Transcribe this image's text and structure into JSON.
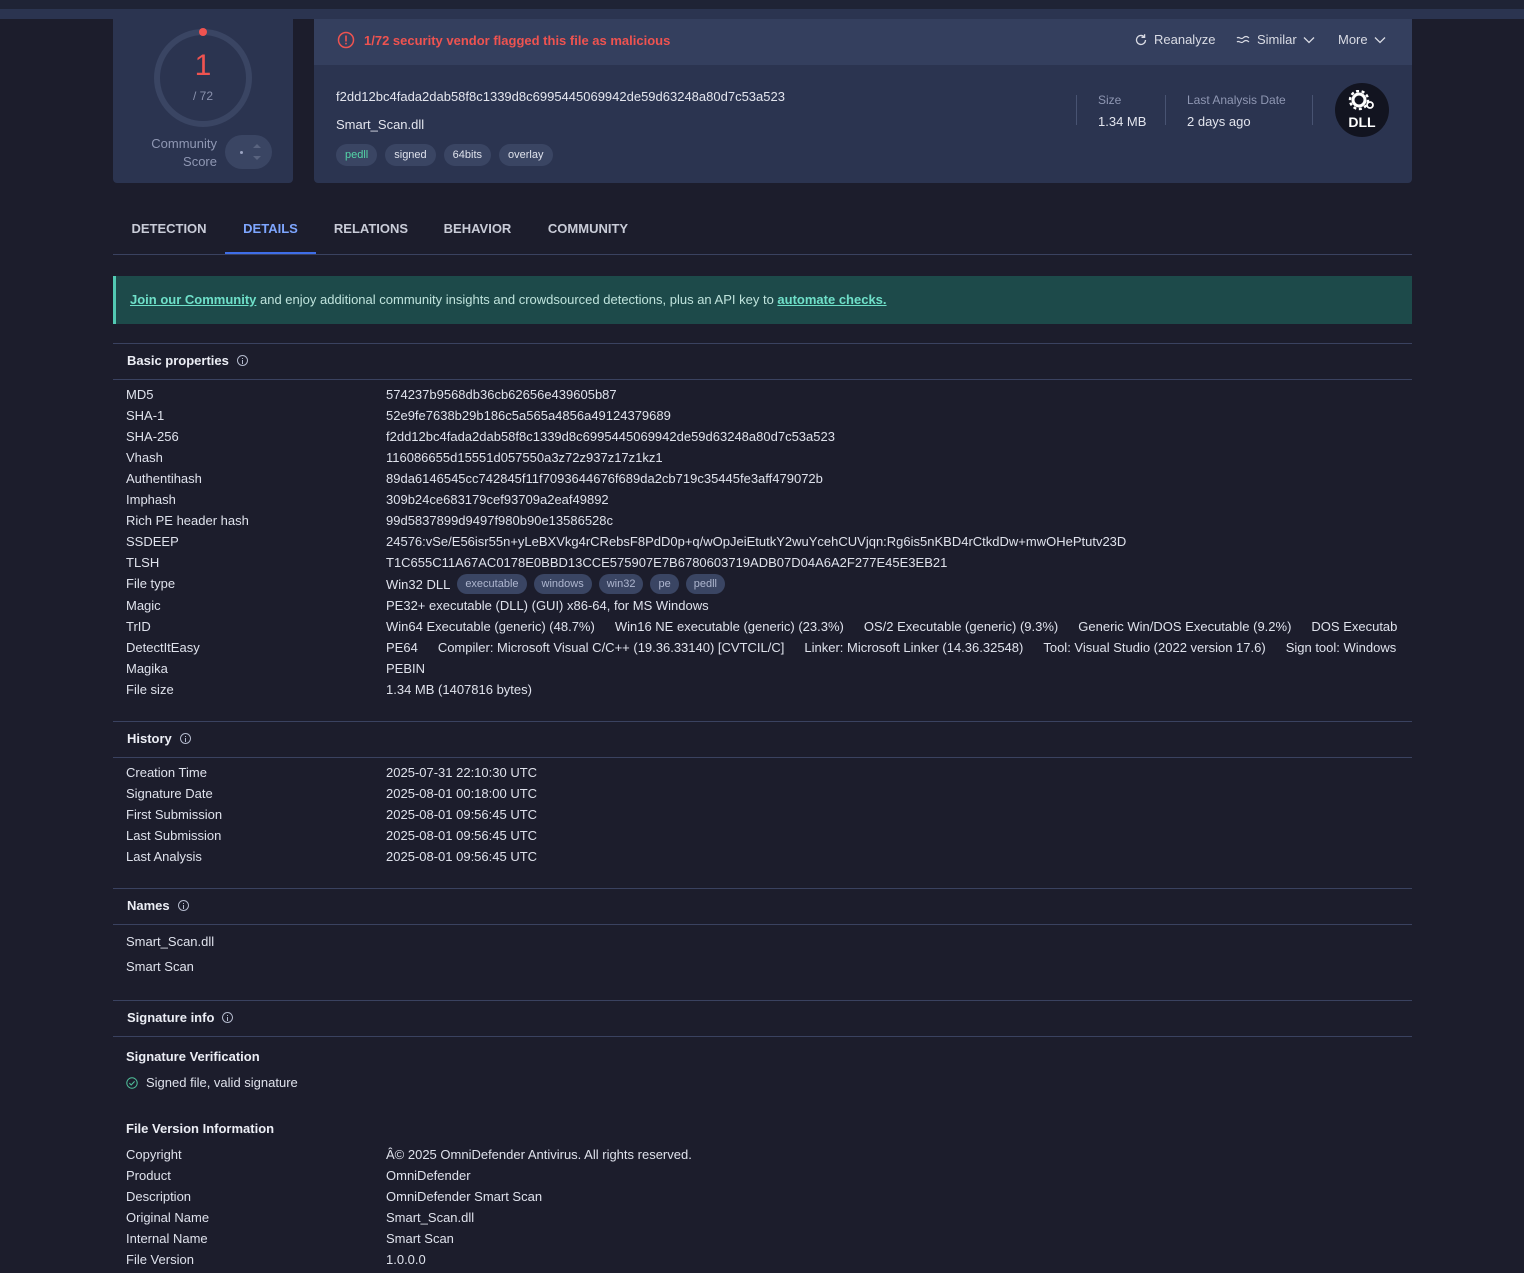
{
  "score": {
    "detections": "1",
    "total": "/ 72",
    "community_label_1": "Community",
    "community_label_2": "Score"
  },
  "alert": {
    "text": "1/72 security vendor flagged this file as malicious",
    "color": "#ef5350"
  },
  "actions": {
    "reanalyze": "Reanalyze",
    "similar": "Similar",
    "more": "More"
  },
  "file": {
    "hash": "f2dd12bc4fada2dab58f8c1339d8c6995445069942de59d63248a80d7c53a523",
    "name": "Smart_Scan.dll",
    "tags": [
      "pedll",
      "signed",
      "64bits",
      "overlay"
    ],
    "size_label": "Size",
    "size_value": "1.34 MB",
    "last_analysis_label": "Last Analysis Date",
    "last_analysis_value": "2 days ago",
    "type_badge": "DLL"
  },
  "tabs": [
    "DETECTION",
    "DETAILS",
    "RELATIONS",
    "BEHAVIOR",
    "COMMUNITY"
  ],
  "active_tab": "DETAILS",
  "banner": {
    "link1": "Join our Community",
    "middle": " and enjoy additional community insights and crowdsourced detections, plus an API key to ",
    "link2": "automate checks."
  },
  "basic": {
    "title": "Basic properties",
    "rows": [
      {
        "k": "MD5",
        "v": "574237b9568db36cb62656e439605b87"
      },
      {
        "k": "SHA-1",
        "v": "52e9fe7638b29b186c5a565a4856a49124379689"
      },
      {
        "k": "SHA-256",
        "v": "f2dd12bc4fada2dab58f8c1339d8c6995445069942de59d63248a80d7c53a523"
      },
      {
        "k": "Vhash",
        "v": "116086655d15551d057550a3z72z937z17z1kz1"
      },
      {
        "k": "Authentihash",
        "v": "89da6146545cc742845f11f7093644676f689da2cb719c35445fe3aff479072b"
      },
      {
        "k": "Imphash",
        "v": "309b24ce683179cef93709a2eaf49892"
      },
      {
        "k": "Rich PE header hash",
        "v": "99d5837899d9497f980b90e13586528c"
      },
      {
        "k": "SSDEEP",
        "v": "24576:vSe/E56isr55n+yLeBXVkg4rCRebsF8PdD0p+q/wOpJeiEtutkY2wuYcehCUVjqn:Rg6is5nKBD4rCtkdDw+mwOHePtutv23D"
      },
      {
        "k": "TLSH",
        "v": "T1C655C11A67AC0178E0BBD13CCE575907E7B6780603719ADB07D04A6A2F277E45E3EB21"
      }
    ],
    "file_type_key": "File type",
    "file_type_value": "Win32 DLL",
    "file_type_tags": [
      "executable",
      "windows",
      "win32",
      "pe",
      "pedll"
    ],
    "magic_key": "Magic",
    "magic_value": "PE32+ executable (DLL) (GUI) x86-64, for MS Windows",
    "trid_key": "TrID",
    "trid": [
      "Win64 Executable (generic) (48.7%)",
      "Win16 NE executable (generic) (23.3%)",
      "OS/2 Executable (generic) (9.3%)",
      "Generic Win/DOS Executable (9.2%)",
      "DOS Executable…"
    ],
    "die_key": "DetectItEasy",
    "die": [
      "PE64",
      "Compiler: Microsoft Visual C/C++ (19.36.33140) [CVTCIL/C]",
      "Linker: Microsoft Linker (14.36.32548)",
      "Tool: Visual Studio (2022 version 17.6)",
      "Sign tool: Windows …"
    ],
    "magika_key": "Magika",
    "magika_value": "PEBIN",
    "filesize_key": "File size",
    "filesize_value": "1.34 MB (1407816 bytes)"
  },
  "history": {
    "title": "History",
    "rows": [
      {
        "k": "Creation Time",
        "v": "2025-07-31 22:10:30 UTC"
      },
      {
        "k": "Signature Date",
        "v": "2025-08-01 00:18:00 UTC"
      },
      {
        "k": "First Submission",
        "v": "2025-08-01 09:56:45 UTC"
      },
      {
        "k": "Last Submission",
        "v": "2025-08-01 09:56:45 UTC"
      },
      {
        "k": "Last Analysis",
        "v": "2025-08-01 09:56:45 UTC"
      }
    ]
  },
  "names": {
    "title": "Names",
    "items": [
      "Smart_Scan.dll",
      "Smart Scan"
    ]
  },
  "signature": {
    "title": "Signature info",
    "verification_title": "Signature Verification",
    "verification_text": "Signed file, valid signature",
    "version_title": "File Version Information",
    "rows": [
      {
        "k": "Copyright",
        "v": "Â© 2025 OmniDefender Antivirus. All rights reserved."
      },
      {
        "k": "Product",
        "v": "OmniDefender"
      },
      {
        "k": "Description",
        "v": "OmniDefender Smart Scan"
      },
      {
        "k": "Original Name",
        "v": "Smart_Scan.dll"
      },
      {
        "k": "Internal Name",
        "v": "Smart Scan"
      },
      {
        "k": "File Version",
        "v": "1.0.0.0"
      }
    ]
  }
}
